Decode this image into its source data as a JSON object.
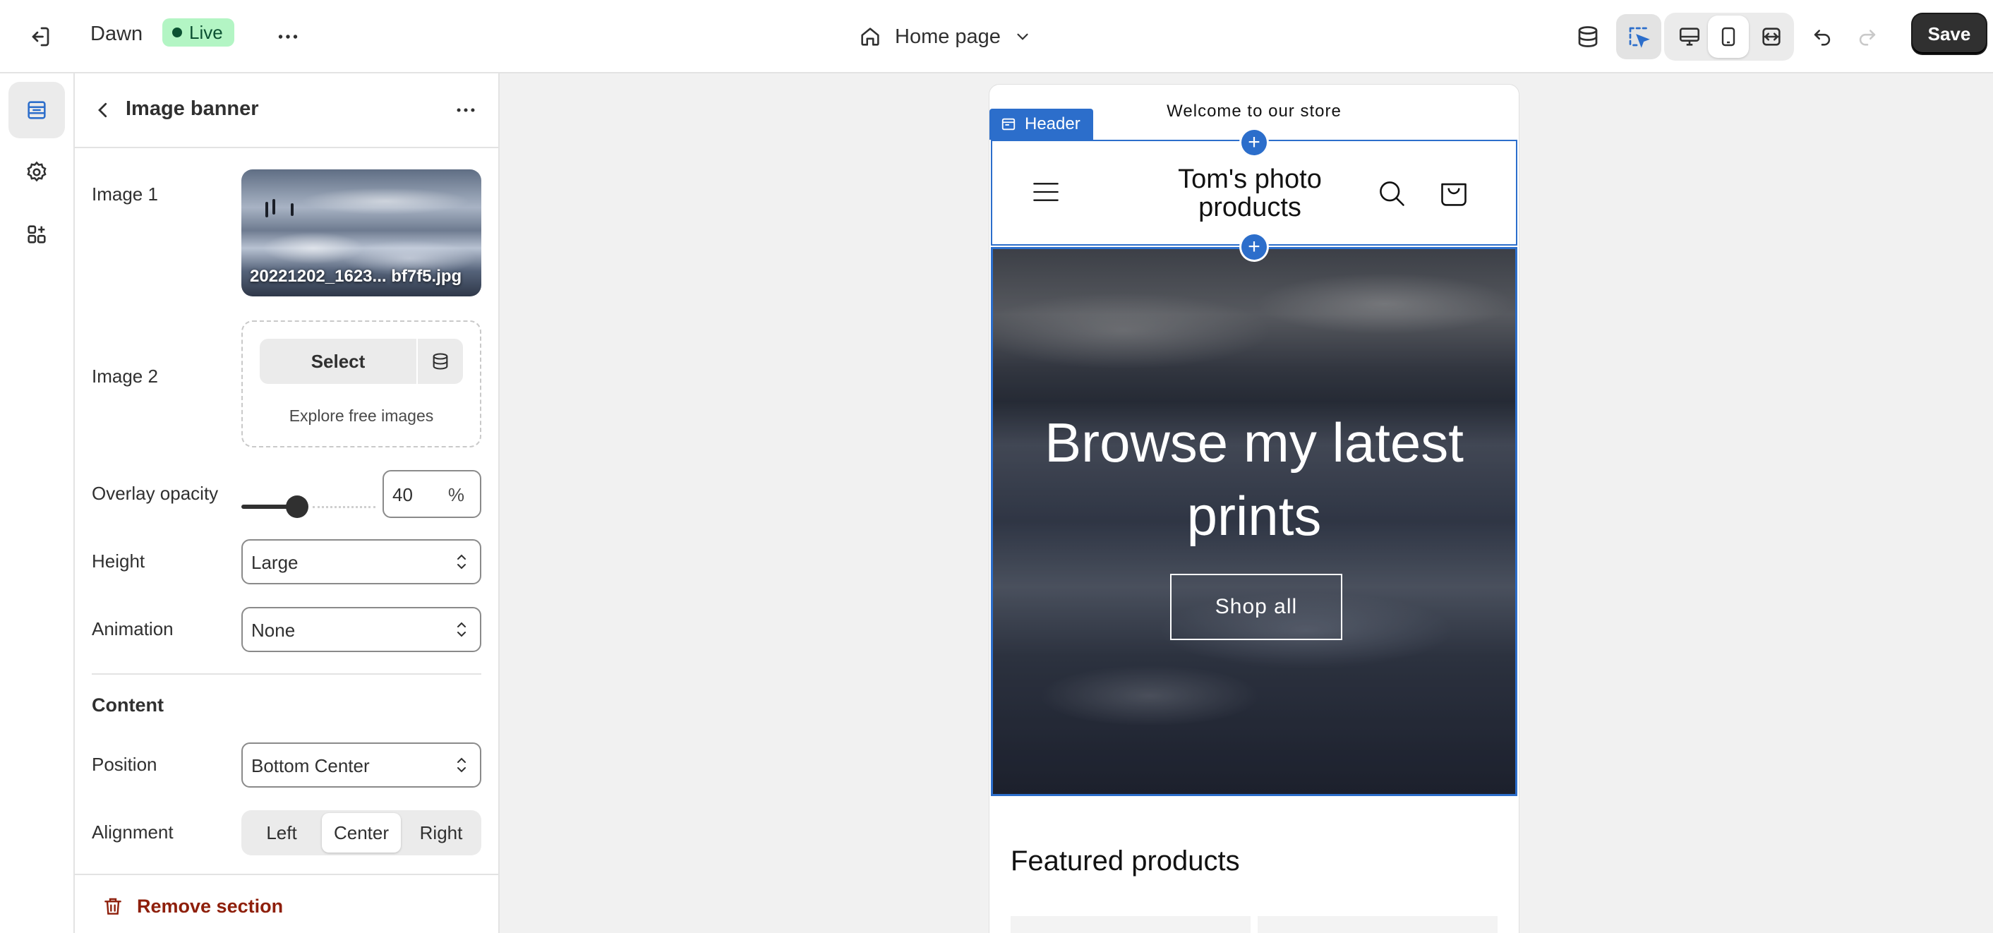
{
  "topbar": {
    "theme_name": "Dawn",
    "status_badge": "Live",
    "page_selector": "Home page",
    "save_label": "Save"
  },
  "panel": {
    "title": "Image banner",
    "image1_label": "Image 1",
    "image1_filename": "20221202_1623... bf7f5.jpg",
    "image2_label": "Image 2",
    "image2_select": "Select",
    "image2_explore": "Explore free images",
    "overlay_label": "Overlay opacity",
    "overlay_value": "40",
    "overlay_unit": "%",
    "overlay_fraction": 0.4,
    "height_label": "Height",
    "height_value": "Large",
    "animation_label": "Animation",
    "animation_value": "None",
    "content_heading": "Content",
    "position_label": "Position",
    "position_value": "Bottom Center",
    "alignment_label": "Alignment",
    "alignment_options": [
      "Left",
      "Center",
      "Right"
    ],
    "alignment_selected": "Center",
    "remove_label": "Remove section"
  },
  "preview": {
    "announcement": "Welcome to our store",
    "header_tag": "Header",
    "logo_text": "Tom's photo products",
    "banner_heading": "Browse my latest prints",
    "banner_button": "Shop all",
    "featured_title": "Featured products"
  },
  "colors": {
    "accent": "#2c6ecb",
    "live_bg": "#b3f5c4",
    "remove": "#8e1f0b",
    "save_bg": "#303030"
  }
}
